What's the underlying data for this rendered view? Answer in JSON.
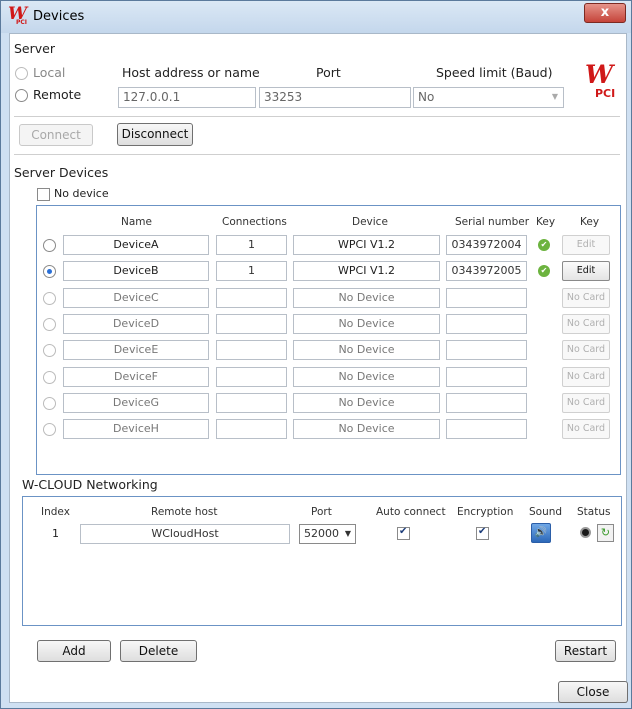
{
  "window": {
    "title": "Devices",
    "logo_text": "W",
    "logo_sub": "PCI",
    "close_glyph": "x"
  },
  "server": {
    "section_label": "Server",
    "local_label": "Local",
    "remote_label": "Remote",
    "selected": "remote",
    "host_label": "Host address or name",
    "port_label": "Port",
    "speed_label": "Speed limit (Baud)",
    "host_value": "127.0.0.1",
    "port_value": "33253",
    "speed_value": "No",
    "connect_label": "Connect",
    "disconnect_label": "Disconnect",
    "brand_w": "W",
    "brand_pci": "PCI"
  },
  "server_devices": {
    "section_label": "Server Devices",
    "no_device_label": "No device",
    "columns": [
      "Name",
      "Connections",
      "Device",
      "Serial number",
      "Key",
      "Key"
    ],
    "rows": [
      {
        "name": "DeviceA",
        "connections": "1",
        "device": "WPCI V1.2",
        "serial": "0343972004",
        "key_ok": true,
        "action": "Edit",
        "action_enabled": false,
        "selected": false,
        "active": true
      },
      {
        "name": "DeviceB",
        "connections": "1",
        "device": "WPCI V1.2",
        "serial": "0343972005",
        "key_ok": true,
        "action": "Edit",
        "action_enabled": true,
        "selected": true,
        "active": true
      },
      {
        "name": "DeviceC",
        "connections": "",
        "device": "No Device",
        "serial": "",
        "key_ok": false,
        "action": "No Card",
        "action_enabled": false,
        "selected": false,
        "active": false
      },
      {
        "name": "DeviceD",
        "connections": "",
        "device": "No Device",
        "serial": "",
        "key_ok": false,
        "action": "No Card",
        "action_enabled": false,
        "selected": false,
        "active": false
      },
      {
        "name": "DeviceE",
        "connections": "",
        "device": "No Device",
        "serial": "",
        "key_ok": false,
        "action": "No Card",
        "action_enabled": false,
        "selected": false,
        "active": false
      },
      {
        "name": "DeviceF",
        "connections": "",
        "device": "No Device",
        "serial": "",
        "key_ok": false,
        "action": "No Card",
        "action_enabled": false,
        "selected": false,
        "active": false
      },
      {
        "name": "DeviceG",
        "connections": "",
        "device": "No Device",
        "serial": "",
        "key_ok": false,
        "action": "No Card",
        "action_enabled": false,
        "selected": false,
        "active": false
      },
      {
        "name": "DeviceH",
        "connections": "",
        "device": "No Device",
        "serial": "",
        "key_ok": false,
        "action": "No Card",
        "action_enabled": false,
        "selected": false,
        "active": false
      }
    ]
  },
  "cloud": {
    "section_label": "W-CLOUD Networking",
    "columns": [
      "Index",
      "Remote host",
      "Port",
      "Auto connect",
      "Encryption",
      "Sound",
      "Status"
    ],
    "rows": [
      {
        "index": "1",
        "host": "WCloudHost",
        "port": "52000",
        "auto_connect": true,
        "encryption": true,
        "sound_icon": "speaker-icon",
        "status_icon": "record-icon",
        "refresh_icon": "refresh-icon"
      }
    ],
    "add_label": "Add",
    "delete_label": "Delete",
    "restart_label": "Restart"
  },
  "footer": {
    "close_label": "Close"
  },
  "colors": {
    "brand_red": "#d01818",
    "key_green": "#6cb33f",
    "panel_border": "#6b93c5",
    "titlebar": "#c4d7ec"
  }
}
